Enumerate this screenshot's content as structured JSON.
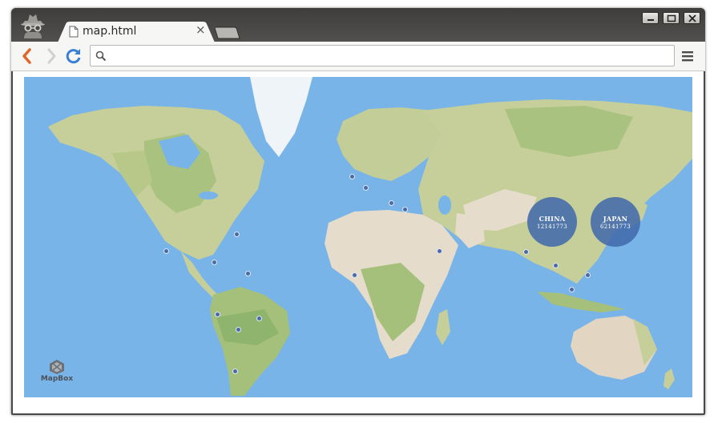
{
  "browser": {
    "tab_title": "map.html",
    "tab_close_glyph": "×",
    "url": "",
    "icons": [
      "incognito-icon",
      "file-icon",
      "close-icon",
      "back-icon",
      "forward-icon",
      "reload-icon",
      "search-icon",
      "menu-icon",
      "minimize-icon",
      "maximize-icon",
      "window-close-icon"
    ],
    "accent_colors": {
      "back": "#e0662b",
      "reload": "#3a7fd6"
    }
  },
  "map": {
    "provider": "MapBox",
    "water_color": "#78b4e8",
    "bubble_color": "#4069aa",
    "bubbles": [
      {
        "name": "CHINA",
        "value": "12141773"
      },
      {
        "name": "JAPAN",
        "value": "62141773"
      }
    ],
    "marker_count": 18
  }
}
